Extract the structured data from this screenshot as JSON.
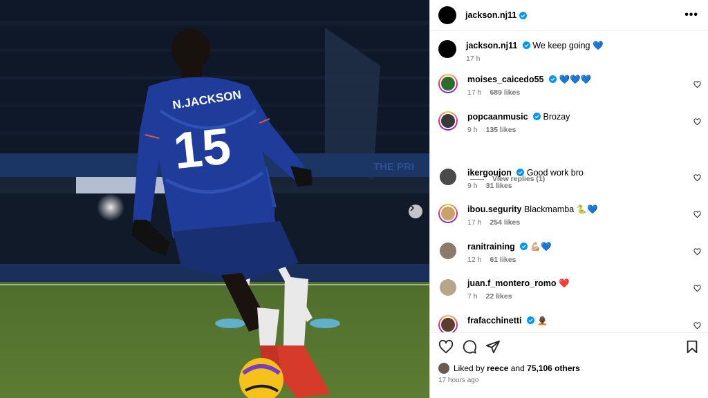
{
  "post": {
    "author": "jackson.nj11",
    "more_label": "•••",
    "caption": {
      "username": "jackson.nj11",
      "text": "We keep going 💙",
      "time": "17 h"
    },
    "photo": {
      "shirt_name": "N.JACKSON",
      "shirt_number": "15",
      "stand_text": "THE PRI"
    }
  },
  "comments": [
    {
      "username": "moises_caicedo55",
      "verified": true,
      "text": "💙💙💙",
      "time": "17 h",
      "likes": "689 likes",
      "avatar_color": "#2f6b2f",
      "ring": true
    },
    {
      "username": "popcaanmusic",
      "verified": true,
      "text": "Brozay",
      "time": "9 h",
      "likes": "135 likes",
      "avatar_color": "#3a3a3a",
      "ring": true
    },
    {
      "username": "ikergoujon",
      "verified": true,
      "text": "Good work bro",
      "time": "9 h",
      "likes": "31 likes",
      "avatar_color": "#4a4a4a",
      "ring": false
    },
    {
      "username": "ibou.segurity",
      "verified": false,
      "text": "Blackmamba 🐍💙",
      "time": "17 h",
      "likes": "254 likes",
      "avatar_color": "#c9a26a",
      "ring": true
    },
    {
      "username": "ranitraining",
      "verified": true,
      "text": "💪🏼💙",
      "time": "12 h",
      "likes": "61 likes",
      "avatar_color": "#8c7a6b",
      "ring": false
    },
    {
      "username": "juan.f_montero_romo",
      "verified": false,
      "text": "❤️",
      "time": "7 h",
      "likes": "22 likes",
      "avatar_color": "#b8a58a",
      "ring": false
    },
    {
      "username": "frafacchinetti",
      "verified": true,
      "text": "🧑🏿‍🦲",
      "time": "",
      "likes": "",
      "avatar_color": "#5a3e30",
      "ring": true
    }
  ],
  "view_replies": "View replies (1)",
  "footer": {
    "liked_by_prefix": "Liked by",
    "liked_by_user": "reece",
    "and": "and",
    "others": "75,106 others",
    "posted": "17 hours ago"
  },
  "colors": {
    "verified_blue": "#0095f6",
    "meta_gray": "#737373",
    "chelsea_blue": "#1f3c9a"
  },
  "icons": {
    "like": "heart-icon",
    "comment": "comment-icon",
    "share": "share-icon",
    "save": "bookmark-icon",
    "next": "chevron-right-icon",
    "more": "more-options-icon"
  }
}
